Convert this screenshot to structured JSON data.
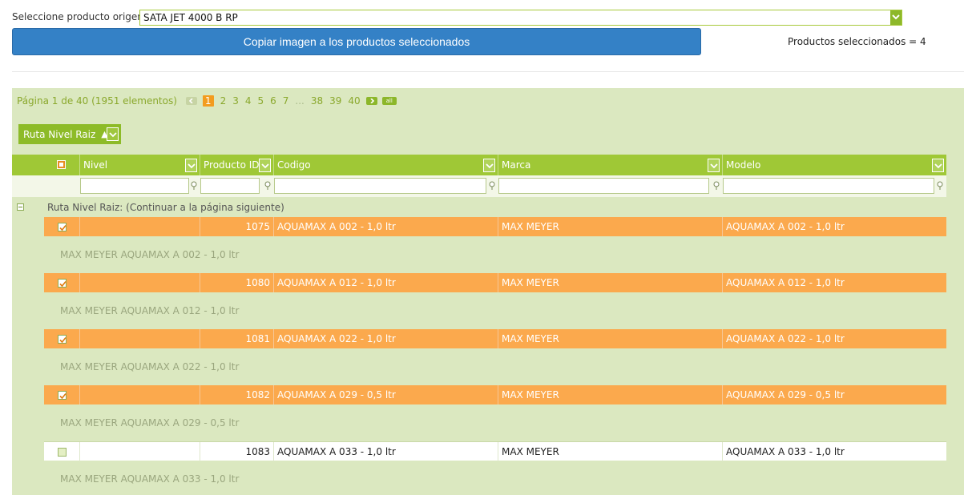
{
  "source": {
    "label": "Seleccione producto origen:*",
    "value": "SATA JET 4000 B RP"
  },
  "copy_button_label": "Copiar imagen a los productos seleccionados",
  "selected_count_text": "Productos seleccionados = 4",
  "pager": {
    "info": "Página 1 de 40 (1951 elementos)",
    "pages": [
      "1",
      "2",
      "3",
      "4",
      "5",
      "6",
      "7",
      "...",
      "38",
      "39",
      "40"
    ],
    "current_page": "1",
    "all_label": "all"
  },
  "group_chip": {
    "label": "Ruta Nivel Raiz",
    "sort": "▲"
  },
  "columns": {
    "nivel": "Nivel",
    "producto_id": "Producto ID",
    "codigo": "Codigo",
    "marca": "Marca",
    "modelo": "Modelo"
  },
  "group_header": "Ruta Nivel Raiz: (Continuar a la página siguiente)",
  "rows": [
    {
      "selected": true,
      "nivel": "",
      "producto_id": "1075",
      "codigo": "AQUAMAX A 002 - 1,0 ltr",
      "marca": "MAX MEYER",
      "modelo": "AQUAMAX A 002 - 1,0 ltr",
      "description": "MAX MEYER AQUAMAX A 002 - 1,0 ltr"
    },
    {
      "selected": true,
      "nivel": "",
      "producto_id": "1080",
      "codigo": "AQUAMAX A 012 - 1,0 ltr",
      "marca": "MAX MEYER",
      "modelo": "AQUAMAX A 012 - 1,0 ltr",
      "description": "MAX MEYER AQUAMAX A 012 - 1,0 ltr"
    },
    {
      "selected": true,
      "nivel": "",
      "producto_id": "1081",
      "codigo": "AQUAMAX A 022 - 1,0 ltr",
      "marca": "MAX MEYER",
      "modelo": "AQUAMAX A 022 - 1,0 ltr",
      "description": "MAX MEYER AQUAMAX A 022 - 1,0 ltr"
    },
    {
      "selected": true,
      "nivel": "",
      "producto_id": "1082",
      "codigo": "AQUAMAX A 029 - 0,5 ltr",
      "marca": "MAX MEYER",
      "modelo": "AQUAMAX A 029 - 0,5 ltr",
      "description": "MAX MEYER AQUAMAX A 029 - 0,5 ltr"
    },
    {
      "selected": false,
      "nivel": "",
      "producto_id": "1083",
      "codigo": "AQUAMAX A 033 - 1,0 ltr",
      "marca": "MAX MEYER",
      "modelo": "AQUAMAX A 033 - 1,0 ltr",
      "description": "MAX MEYER AQUAMAX A 033 - 1,0 ltr"
    }
  ],
  "colors": {
    "primary_button": "#3481c6",
    "grid_header": "#9fc836",
    "selected_row": "#fba94d",
    "current_page": "#f39c1f",
    "panel_bg": "#dbe8c0"
  },
  "icons": {
    "dropdown": "chevron-down-icon",
    "filter": "filter-icon",
    "check": "check-icon",
    "collapse": "minus-icon"
  }
}
